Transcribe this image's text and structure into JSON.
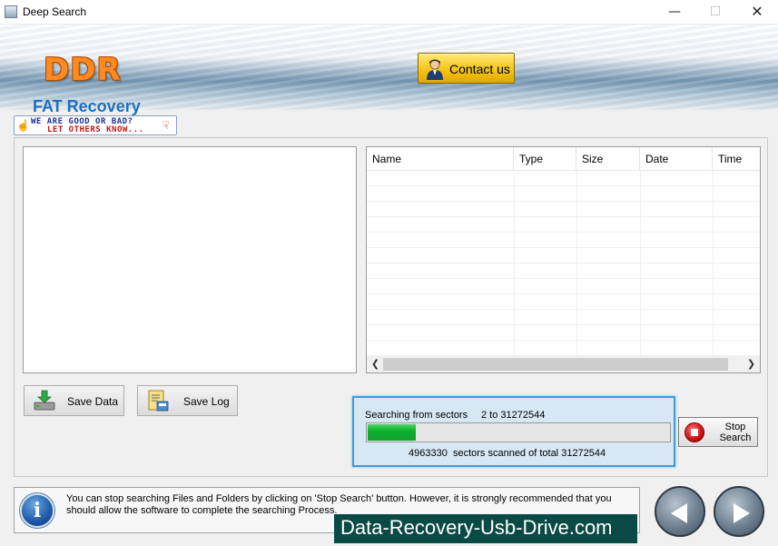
{
  "window": {
    "title": "Deep Search",
    "minimize_glyph": "—",
    "maximize_glyph": "☐",
    "close_glyph": "✕"
  },
  "header": {
    "logo": "DDR",
    "product": "FAT Recovery",
    "contact_label": "Contact us"
  },
  "feedback": {
    "line1": "WE ARE GOOD OR BAD?",
    "line2": "LET OTHERS KNOW..."
  },
  "file_list": {
    "columns": [
      "Name",
      "Type",
      "Size",
      "Date",
      "Time"
    ]
  },
  "buttons": {
    "save_data": "Save Data",
    "save_log": "Save Log",
    "stop_search_line1": "Stop",
    "stop_search_line2": "Search"
  },
  "progress": {
    "searching_label": "Searching from sectors",
    "sector_range": "2 to 31272544",
    "scanned_count": "4963330",
    "scanned_label": "sectors scanned of total",
    "total": "31272544",
    "fraction": 0.159
  },
  "info": {
    "message": "You can stop searching Files and Folders by clicking on 'Stop Search' button. However, it is strongly recommended that you should allow the software to complete the searching Process."
  },
  "watermark": "Data-Recovery-Usb-Drive.com",
  "icons": {
    "app": "app-icon",
    "contact": "person-icon",
    "save_data": "download-drive-icon",
    "save_log": "log-file-icon",
    "stop": "stop-icon",
    "info": "info-icon",
    "back": "back-arrow-icon",
    "next": "next-arrow-icon"
  },
  "colors": {
    "accent": "#3b9ce0",
    "progress": "#06b025",
    "logo": "#ff8a22",
    "product": "#1f6fbd"
  }
}
